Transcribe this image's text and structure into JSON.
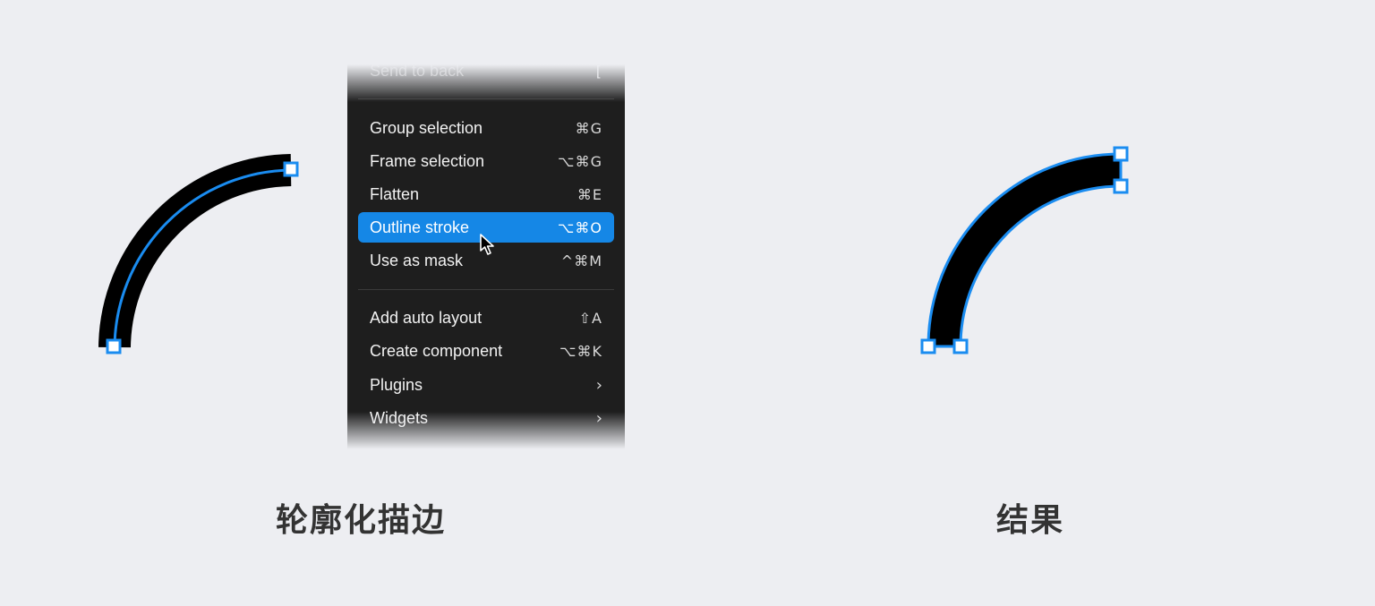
{
  "menu": {
    "items": [
      {
        "label": "Send to back",
        "shortcut": "[",
        "state": "faded"
      },
      {
        "label": "Group selection",
        "shortcut": "⌘G"
      },
      {
        "label": "Frame selection",
        "shortcut": "⌥⌘G"
      },
      {
        "label": "Flatten",
        "shortcut": "⌘E"
      },
      {
        "label": "Outline stroke",
        "shortcut": "⌥⌘O",
        "state": "highlighted"
      },
      {
        "label": "Use as mask",
        "shortcut": "^⌘M"
      },
      {
        "label": "Add auto layout",
        "shortcut": "⇧A"
      },
      {
        "label": "Create component",
        "shortcut": "⌥⌘K"
      },
      {
        "label": "Plugins",
        "submenu": "›"
      },
      {
        "label": "Widgets",
        "submenu": "›"
      }
    ]
  },
  "captions": {
    "left": "轮廓化描边",
    "right": "结果"
  },
  "colors": {
    "background": "#edeef2",
    "menu_background": "#1e1e1e",
    "highlight": "#1587e6",
    "selection": "#1a8cf0",
    "stroke_fill": "#000000"
  },
  "icons": {
    "cursor": "arrow-cursor-icon",
    "handle": "square-handle-icon"
  }
}
